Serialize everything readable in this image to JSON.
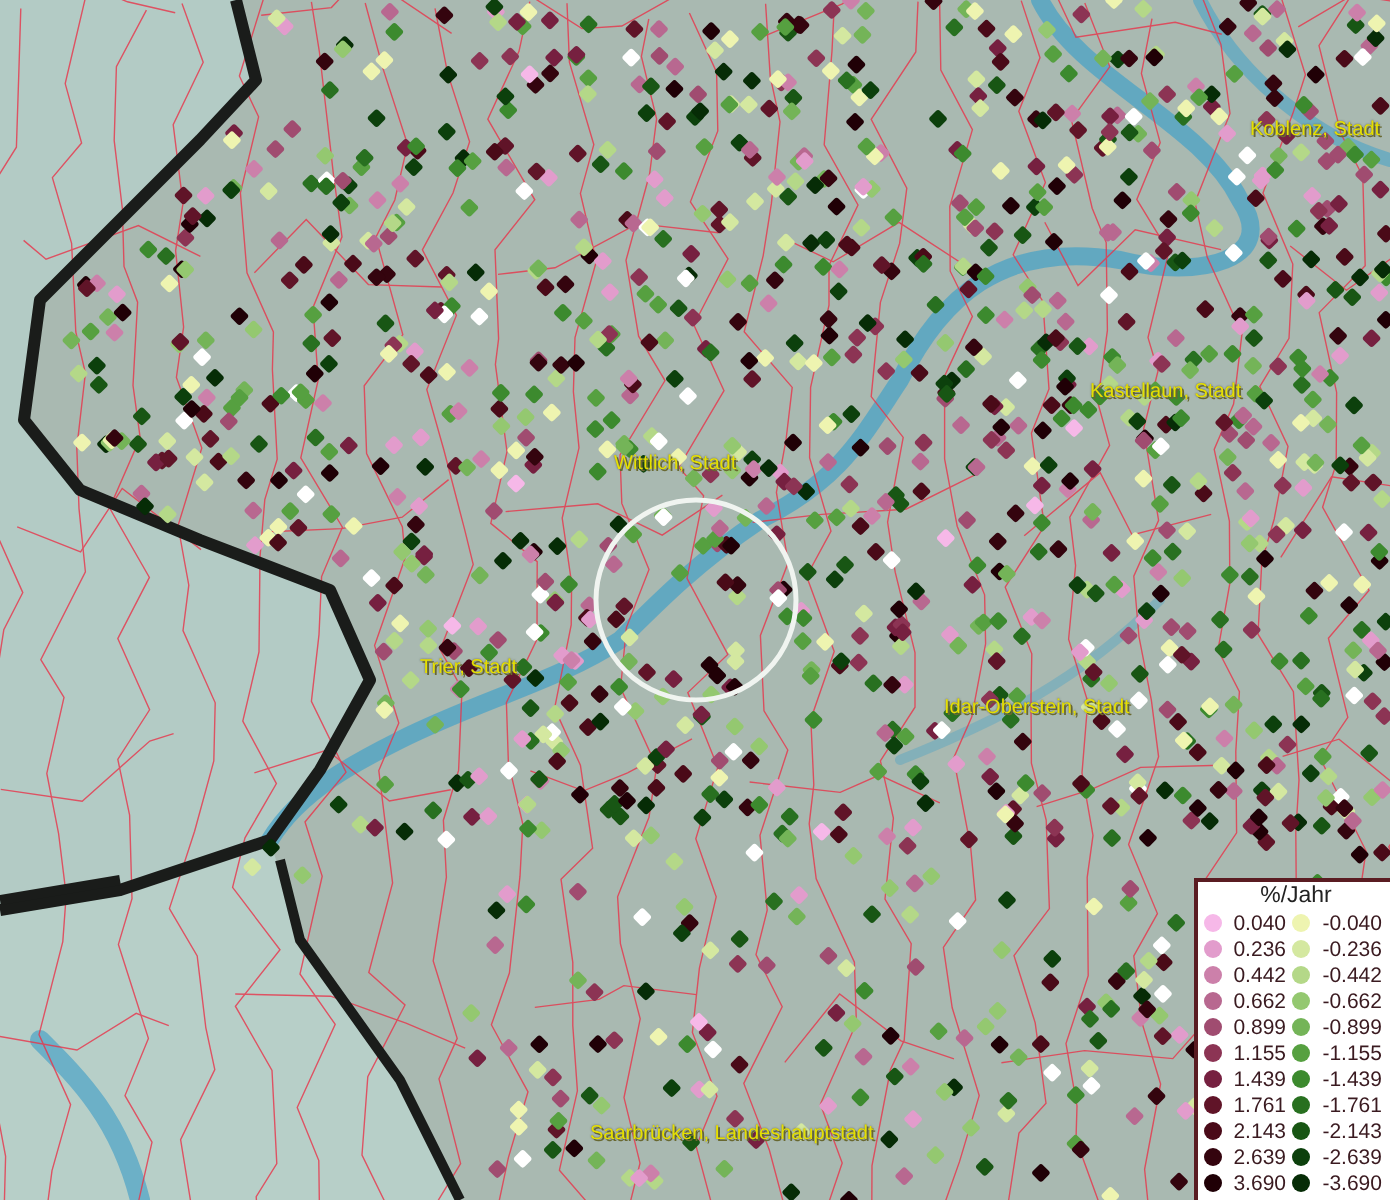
{
  "map": {
    "labels": [
      {
        "text": "Koblenz, Stadt"
      },
      {
        "text": "Kastellaun, Stadt"
      },
      {
        "text": "Wittlich, Stadt"
      },
      {
        "text": "Trier, Stadt"
      },
      {
        "text": "Idar-Oberstein, Stadt"
      },
      {
        "text": "Saarbrücken, Landeshauptstadt"
      }
    ]
  },
  "legend": {
    "title": "%/Jahr",
    "rows": [
      {
        "positive": {
          "label": "0.040",
          "color": "#f6b8e8"
        },
        "negative": {
          "label": "-0.040",
          "color": "#eef4b0"
        }
      },
      {
        "positive": {
          "label": "0.236",
          "color": "#e29ccc"
        },
        "negative": {
          "label": "-0.236",
          "color": "#d4e8a0"
        }
      },
      {
        "positive": {
          "label": "0.442",
          "color": "#cc80aa"
        },
        "negative": {
          "label": "-0.442",
          "color": "#b4d888"
        }
      },
      {
        "positive": {
          "label": "0.662",
          "color": "#b86890"
        },
        "negative": {
          "label": "-0.662",
          "color": "#94c870"
        }
      },
      {
        "positive": {
          "label": "0.899",
          "color": "#a04c70"
        },
        "negative": {
          "label": "-0.899",
          "color": "#74b458"
        }
      },
      {
        "positive": {
          "label": "1.155",
          "color": "#8c3454"
        },
        "negative": {
          "label": "-1.155",
          "color": "#56a040"
        }
      },
      {
        "positive": {
          "label": "1.439",
          "color": "#762040"
        },
        "negative": {
          "label": "-1.439",
          "color": "#3c8a2e"
        }
      },
      {
        "positive": {
          "label": "1.761",
          "color": "#601428"
        },
        "negative": {
          "label": "-1.761",
          "color": "#287020"
        }
      },
      {
        "positive": {
          "label": "2.143",
          "color": "#4a0a18"
        },
        "negative": {
          "label": "-2.143",
          "color": "#185614"
        }
      },
      {
        "positive": {
          "label": "2.639",
          "color": "#34040e"
        },
        "negative": {
          "label": "-2.639",
          "color": "#0c400c"
        }
      },
      {
        "positive": {
          "label": "3.690",
          "color": "#200006"
        },
        "negative": {
          "label": "-3.690",
          "color": "#062c06"
        }
      }
    ]
  }
}
